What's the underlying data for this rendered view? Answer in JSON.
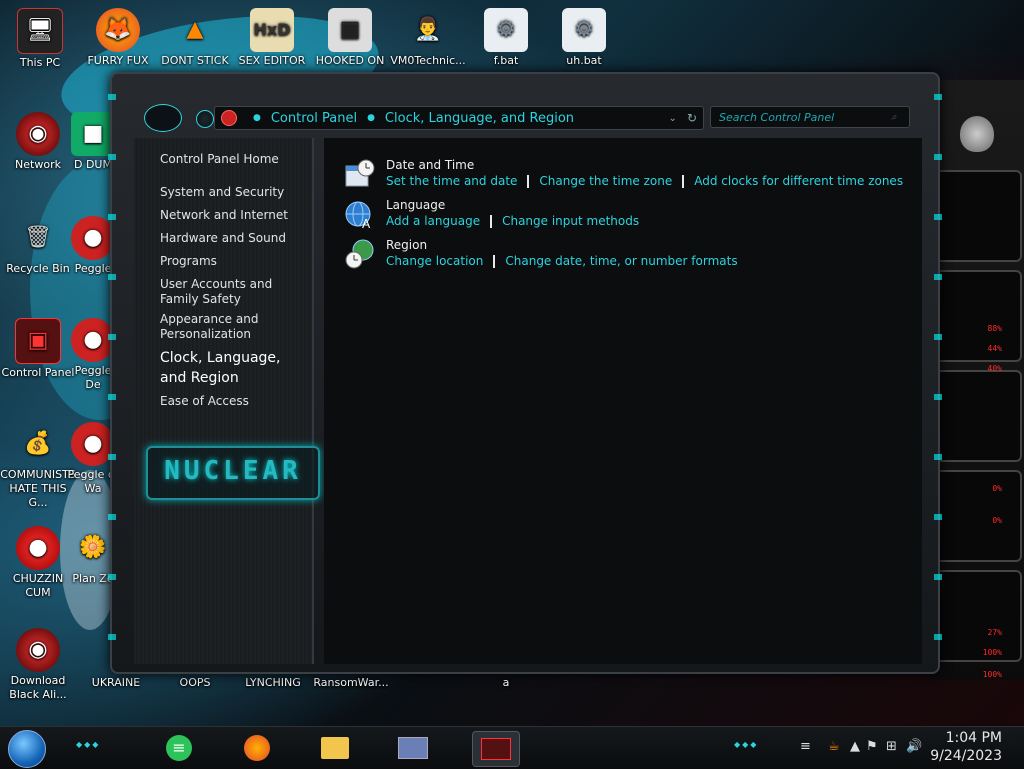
{
  "desktop": {
    "icons": [
      {
        "label": "This PC"
      },
      {
        "label": "FURRY FUX"
      },
      {
        "label": "DONT STICK"
      },
      {
        "label": "SEX EDITOR"
      },
      {
        "label": "HOOKED ON"
      },
      {
        "label": "VM0Technic..."
      },
      {
        "label": "f.bat"
      },
      {
        "label": "uh.bat"
      },
      {
        "label": "Network"
      },
      {
        "label": "Recycle Bin"
      },
      {
        "label": "Control Panel"
      },
      {
        "label": "COMMUNISTS HATE THIS G..."
      },
      {
        "label": "CHUZZIN CUM"
      },
      {
        "label": "Download Black Ali..."
      },
      {
        "label": "UKRAINE"
      },
      {
        "label": "OOPS"
      },
      {
        "label": "LYNCHING"
      },
      {
        "label": "RansomWar..."
      },
      {
        "label": "a"
      },
      {
        "label": "D DUM"
      },
      {
        "label": "Peggle"
      },
      {
        "label": "Peggle De"
      },
      {
        "label": "Peggle of Wa"
      },
      {
        "label": "Plan Zo"
      }
    ]
  },
  "window": {
    "breadcrumb": [
      "Control Panel",
      "Clock, Language, and Region"
    ],
    "search_placeholder": "Search Control Panel",
    "nav": {
      "items": [
        {
          "label": "Control Panel Home"
        },
        {
          "label": "System and Security"
        },
        {
          "label": "Network and Internet"
        },
        {
          "label": "Hardware and Sound"
        },
        {
          "label": "Programs"
        },
        {
          "label": "User Accounts and Family Safety"
        },
        {
          "label": "Appearance and Personalization"
        },
        {
          "label": "Clock, Language, and Region"
        },
        {
          "label": "Ease of Access"
        }
      ],
      "active_index": 7,
      "badge_text": "NUCLEAR"
    },
    "categories": [
      {
        "title": "Date and Time",
        "icon": "calendar-clock-icon",
        "links": [
          "Set the time and date",
          "Change the time zone",
          "Add clocks for different time zones"
        ]
      },
      {
        "title": "Language",
        "icon": "globe-language-icon",
        "links": [
          "Add a language",
          "Change input methods"
        ]
      },
      {
        "title": "Region",
        "icon": "globe-clock-icon",
        "links": [
          "Change location",
          "Change date, time, or number formats"
        ]
      }
    ]
  },
  "side_widget": {
    "readouts": [
      "88%",
      "44%",
      "40%",
      "0%",
      "0%",
      "27%",
      "100%",
      "100%"
    ]
  },
  "taskbar": {
    "time": "1:04 PM",
    "date": "9/24/2023"
  },
  "colors": {
    "accent": "#2dd3df",
    "warn": "#ff2a2a"
  }
}
